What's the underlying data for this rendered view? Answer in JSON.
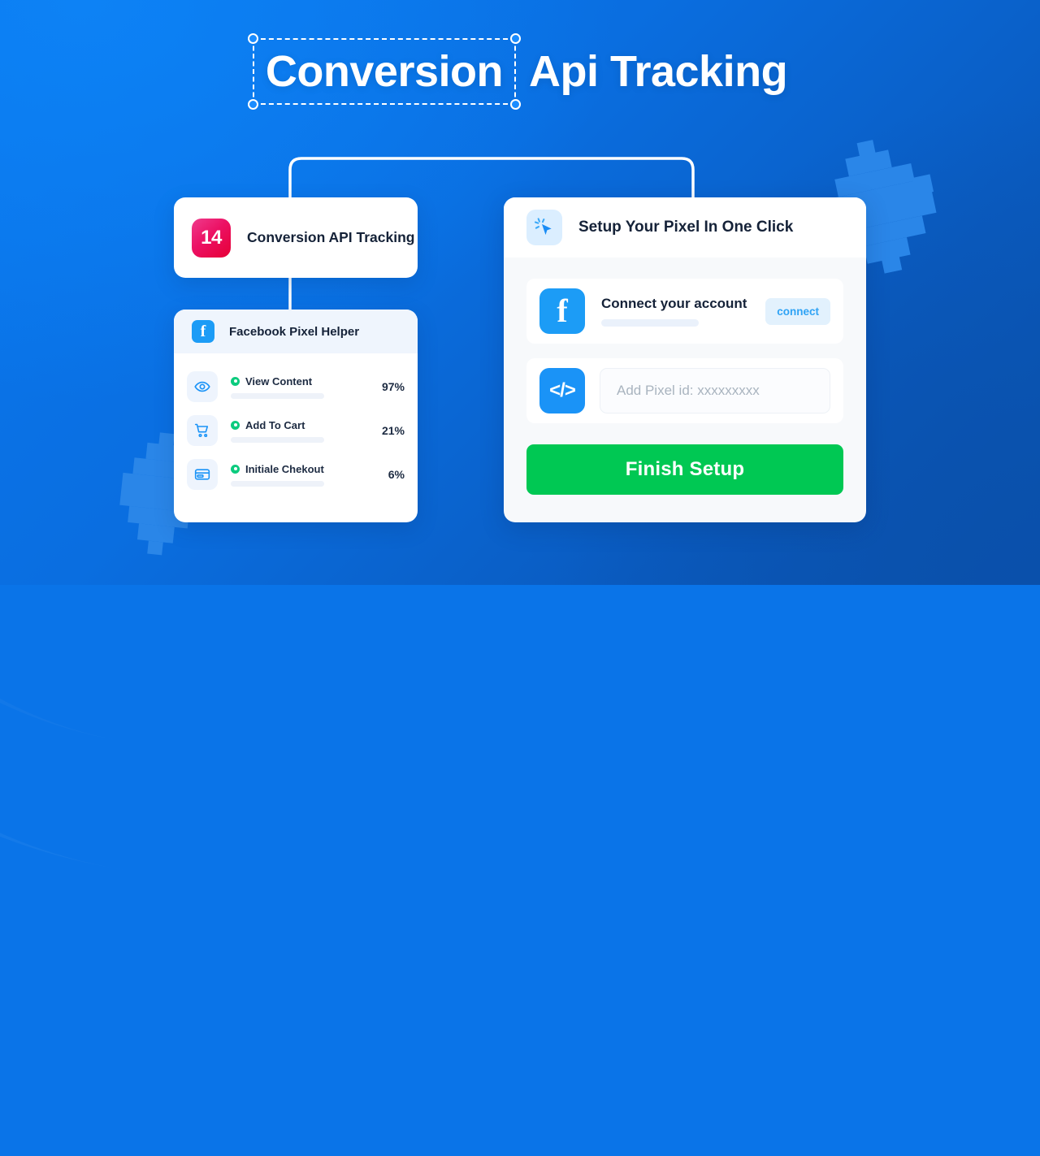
{
  "title": {
    "selected_text": "Conversion",
    "rest_text": "Api Tracking"
  },
  "tracking_card": {
    "badge": "14",
    "label": "Conversion API Tracking"
  },
  "helper_card": {
    "icon": "facebook-icon",
    "title": "Facebook Pixel Helper",
    "metrics": [
      {
        "icon": "eye-icon",
        "label": "View Content",
        "percent": "97%"
      },
      {
        "icon": "cart-icon",
        "label": "Add To Cart",
        "percent": "21%"
      },
      {
        "icon": "credit-card-icon",
        "label": "Initiale Chekout",
        "percent": "6%"
      }
    ]
  },
  "panel": {
    "icon": "click-cursor-icon",
    "title": "Setup Your Pixel In One Click",
    "connect_row": {
      "icon": "facebook-icon",
      "title": "Connect your account",
      "button_label": "connect"
    },
    "pixel_row": {
      "icon": "code-icon",
      "input_value": "",
      "input_placeholder": "Add Pixel id: xxxxxxxxx"
    },
    "finish_label": "Finish Setup"
  },
  "colors": {
    "background_start": "#0a78ef",
    "background_end": "#0b53ae",
    "accent_blue": "#1a93f7",
    "badge_pink": "#e60036",
    "success_green": "#00c853",
    "dot_green": "#0ccb7e"
  }
}
